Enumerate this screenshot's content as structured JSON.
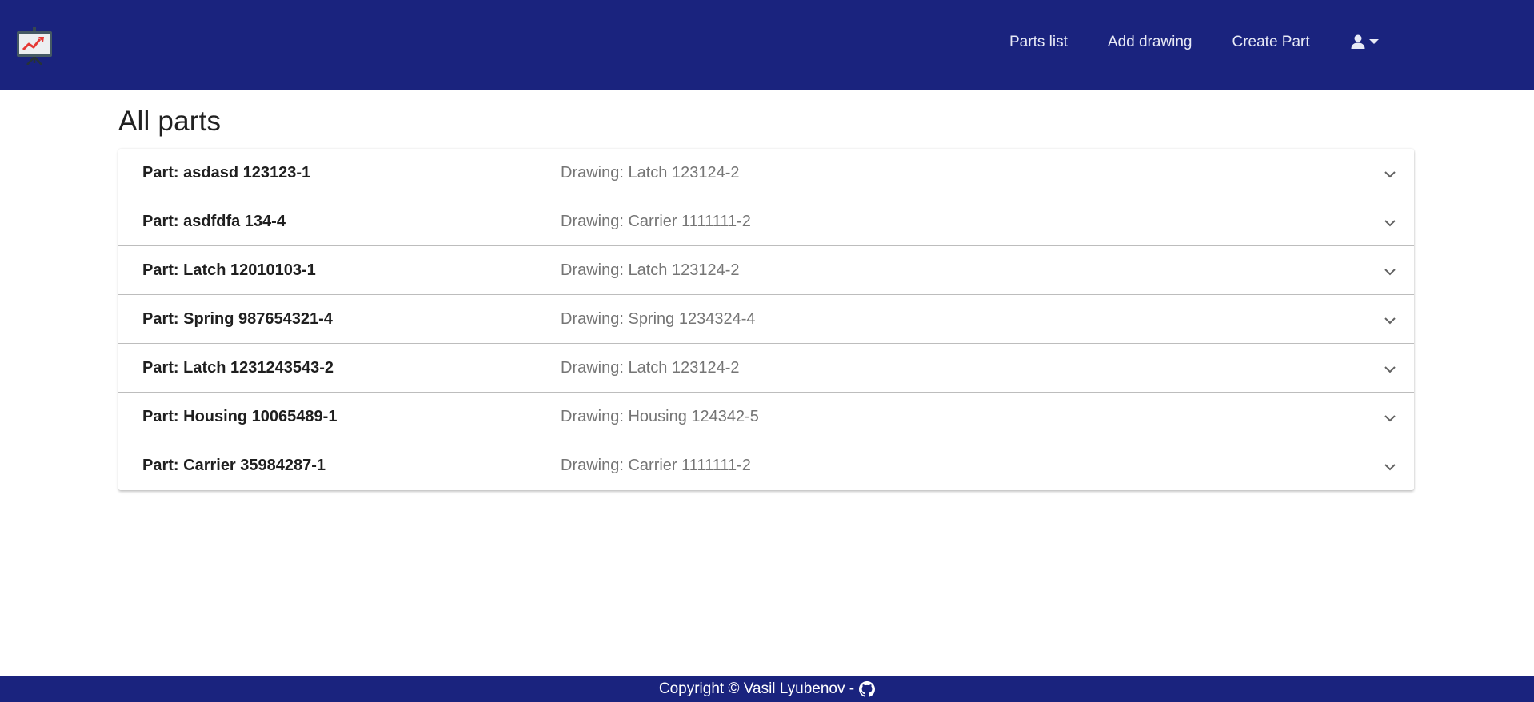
{
  "header": {
    "logo_icon": "presentation-chart-icon",
    "nav": [
      {
        "label": "Parts list"
      },
      {
        "label": "Add drawing"
      },
      {
        "label": "Create Part"
      }
    ],
    "user_icon": "account-icon",
    "user_caret_icon": "caret-down-icon"
  },
  "main": {
    "title": "All parts",
    "parts": [
      {
        "part": "Part: asdasd 123123-1",
        "drawing": "Drawing: Latch 123124-2"
      },
      {
        "part": "Part: asdfdfa 134-4",
        "drawing": "Drawing: Carrier 1111111-2"
      },
      {
        "part": "Part: Latch 12010103-1",
        "drawing": "Drawing: Latch 123124-2"
      },
      {
        "part": "Part: Spring 987654321-4",
        "drawing": "Drawing: Spring 1234324-4"
      },
      {
        "part": "Part: Latch 1231243543-2",
        "drawing": "Drawing: Latch 123124-2"
      },
      {
        "part": "Part: Housing 10065489-1",
        "drawing": "Drawing: Housing 124342-5"
      },
      {
        "part": "Part: Carrier 35984287-1",
        "drawing": "Drawing: Carrier 1111111-2"
      }
    ],
    "expand_icon": "chevron-down-icon"
  },
  "footer": {
    "text": "Copyright © Vasil Lyubenov -",
    "icon": "github-icon"
  },
  "colors": {
    "primary": "#1a237e",
    "nav_text": "#e8eaf6",
    "secondary_text": "#757575"
  }
}
